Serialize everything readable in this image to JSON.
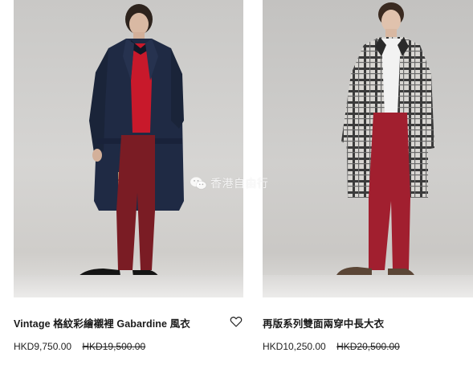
{
  "products": [
    {
      "title": "Vintage 格紋彩繪襯裡 Gabardine 風衣",
      "price_current": "HKD9,750.00",
      "price_original": "HKD19,500.00",
      "wishlist_icon": "heart-outline-icon"
    },
    {
      "title": "再版系列雙面兩穿中長大衣",
      "price_current": "HKD10,250.00",
      "price_original": "HKD20,500.00"
    }
  ],
  "watermark": {
    "text": "香港自由行",
    "icon": "wechat-icon"
  },
  "colors": {
    "navy_coat": "#1f2a44",
    "burgundy": "#7a1c24",
    "red_sweater": "#c8192b",
    "plaid_light": "#d8d6d2",
    "plaid_dark": "#2a2a2a"
  }
}
